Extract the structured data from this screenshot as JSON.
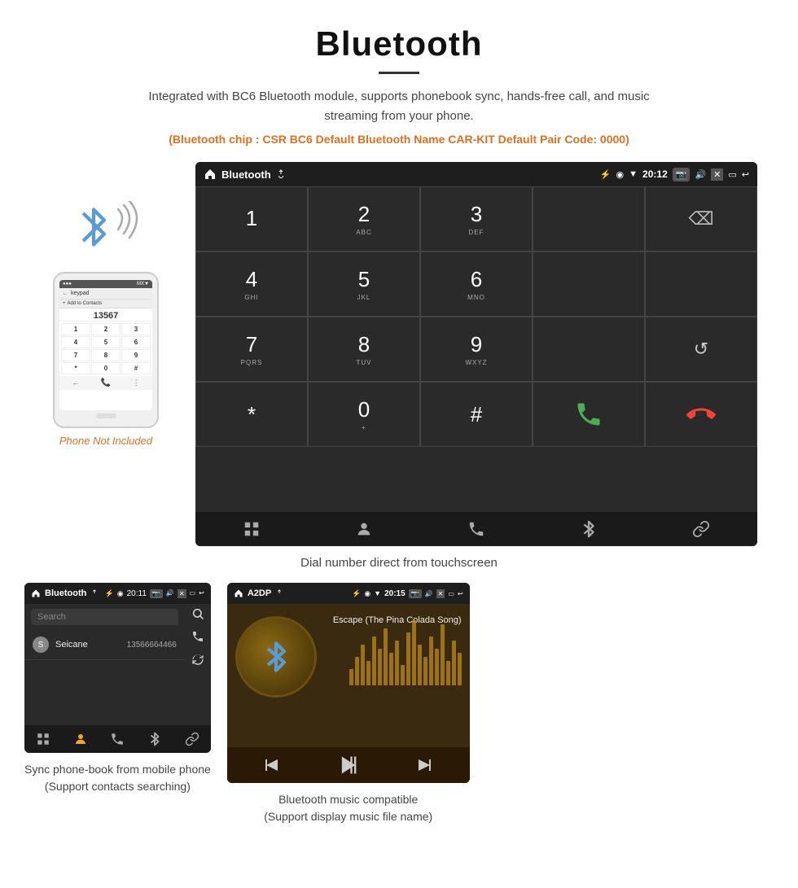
{
  "header": {
    "title": "Bluetooth",
    "description": "Integrated with BC6 Bluetooth module, supports phonebook sync, hands-free call, and music streaming from your phone.",
    "bt_info": "(Bluetooth chip : CSR BC6    Default Bluetooth Name CAR-KIT    Default Pair Code: 0000)"
  },
  "android_dial": {
    "app_title": "Bluetooth",
    "time": "20:12",
    "keys": [
      {
        "label": "1",
        "sub": ""
      },
      {
        "label": "2",
        "sub": "ABC"
      },
      {
        "label": "3",
        "sub": "DEF"
      },
      {
        "label": "",
        "sub": ""
      },
      {
        "label": "⌫",
        "sub": ""
      },
      {
        "label": "4",
        "sub": "GHI"
      },
      {
        "label": "5",
        "sub": "JKL"
      },
      {
        "label": "6",
        "sub": "MNO"
      },
      {
        "label": "",
        "sub": ""
      },
      {
        "label": "",
        "sub": ""
      },
      {
        "label": "7",
        "sub": "PQRS"
      },
      {
        "label": "8",
        "sub": "TUV"
      },
      {
        "label": "9",
        "sub": "WXYZ"
      },
      {
        "label": "",
        "sub": ""
      },
      {
        "label": "↺",
        "sub": ""
      },
      {
        "label": "*",
        "sub": ""
      },
      {
        "label": "0",
        "sub": "+"
      },
      {
        "label": "#",
        "sub": ""
      },
      {
        "label": "📞",
        "sub": ""
      },
      {
        "label": "📞end",
        "sub": ""
      }
    ]
  },
  "dial_caption": "Dial number direct from touchscreen",
  "phonebook": {
    "app_title": "Bluetooth",
    "time": "20:11",
    "search_placeholder": "Search",
    "contacts": [
      {
        "letter": "S",
        "name": "Seicane",
        "number": "13566664466"
      }
    ],
    "caption": "Sync phone-book from mobile phone\n(Support contacts searching)"
  },
  "music": {
    "app_title": "A2DP",
    "time": "20:15",
    "song_name": "Escape (The Pina Colada Song)",
    "caption": "Bluetooth music compatible\n(Support display music file name)"
  },
  "phone_aside": {
    "not_included": "Phone Not Included"
  },
  "nav_icons": {
    "grid": "⊞",
    "person": "👤",
    "phone": "📞",
    "bluetooth": "⌘",
    "link": "🔗"
  }
}
